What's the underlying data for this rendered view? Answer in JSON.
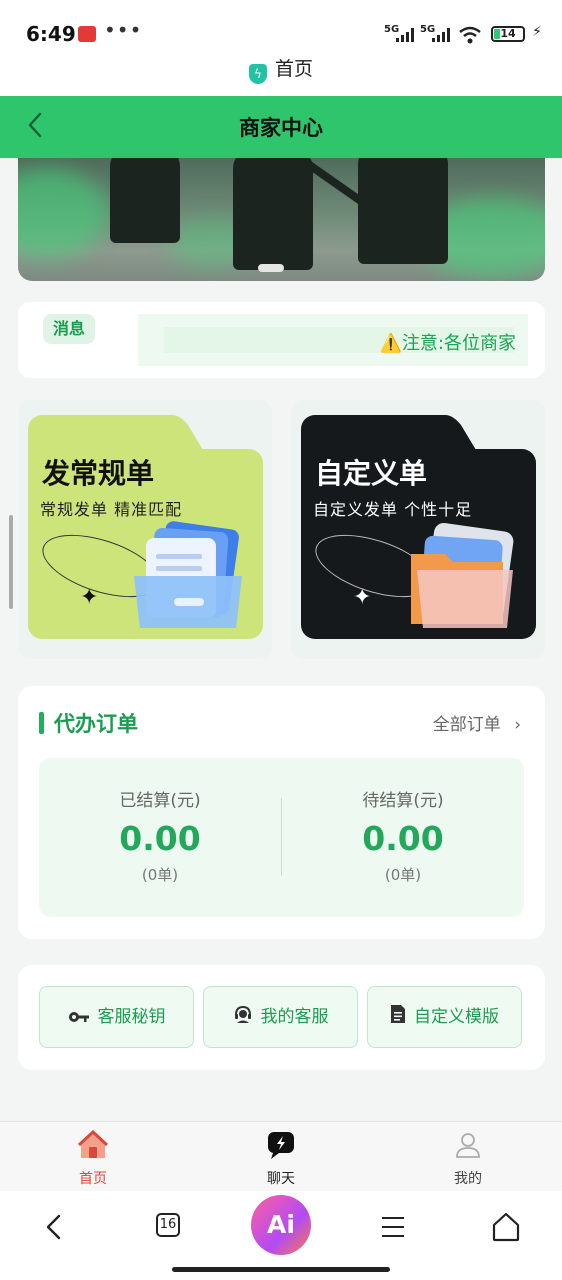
{
  "status_bar": {
    "time": "6:49",
    "overflow": "•••",
    "network_1": "5G",
    "network_2": "5G",
    "battery": "14"
  },
  "url_bar": {
    "title": "首页"
  },
  "header": {
    "title": "商家中心"
  },
  "notice": {
    "tag": "消息",
    "text": "⚠️注意:各位商家"
  },
  "order_types": [
    {
      "title": "发常规单",
      "subtitle": "常规发单 精准匹配",
      "color": "#cde47b"
    },
    {
      "title": "自定义单",
      "subtitle": "自定义发单 个性十足",
      "color": "#15191b"
    }
  ],
  "orders": {
    "title": "代办订单",
    "all_link": "全部订单",
    "settled": {
      "label": "已结算(元)",
      "value": "0.00",
      "count": "(0单)"
    },
    "pending": {
      "label": "待结算(元)",
      "value": "0.00",
      "count": "(0单)"
    }
  },
  "actions": [
    {
      "label": "客服秘钥",
      "icon": "key-icon"
    },
    {
      "label": "我的客服",
      "icon": "headset-icon"
    },
    {
      "label": "自定义模版",
      "icon": "document-icon"
    }
  ],
  "tabbar": [
    {
      "label": "首页",
      "icon": "home-icon",
      "active": true
    },
    {
      "label": "聊天",
      "icon": "chat-icon",
      "active": false
    },
    {
      "label": "我的",
      "icon": "user-icon",
      "active": false
    }
  ],
  "system_nav": {
    "tabs_count": "16",
    "ai_label": "Ai"
  },
  "colors": {
    "brand_green": "#2ec56d",
    "accent_green": "#23a85b"
  }
}
